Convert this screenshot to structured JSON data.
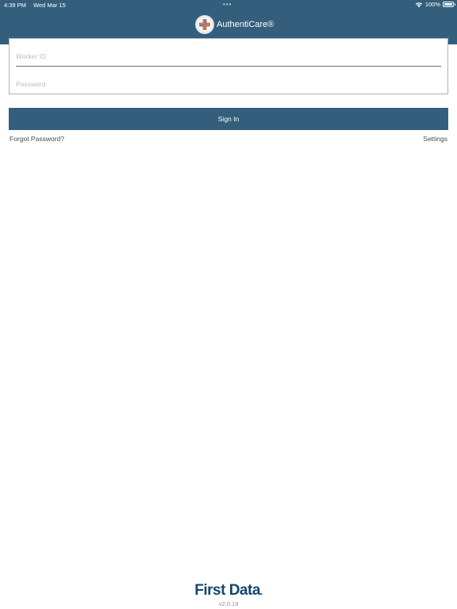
{
  "status_bar": {
    "time": "4:39 PM",
    "date": "Wed Mar 15",
    "dots": "•••",
    "battery": "100%"
  },
  "header": {
    "app_name": "AuthentiCare®",
    "logo_icon": "authenticare-cross-logo",
    "background_color": "#345f7c"
  },
  "login_form": {
    "worker_id_placeholder": "Worker ID",
    "worker_id_value": "",
    "password_placeholder": "Password",
    "password_value": ""
  },
  "actions": {
    "signin_label": "Sign In",
    "forgot_password_label": "Forgot Password?",
    "settings_label": "Settings"
  },
  "footer": {
    "brand": "First Data",
    "brand_mark": ".",
    "version": "v2.0.19"
  }
}
